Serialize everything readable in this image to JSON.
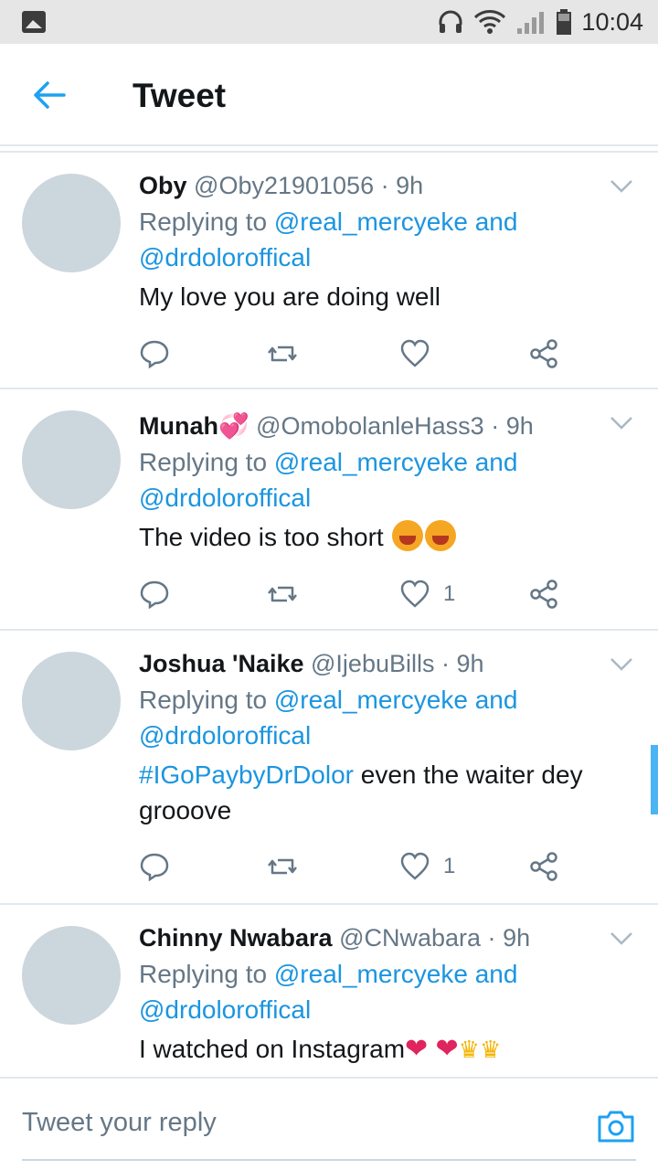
{
  "status_bar": {
    "time": "10:04"
  },
  "header": {
    "title": "Tweet"
  },
  "tweets": [
    {
      "name": "Oby",
      "name_emoji": "",
      "handle": "@Oby21901056",
      "dot": "·",
      "time": "9h",
      "replying_prefix": "Replying to",
      "mention1": "@real_mercyeke",
      "and": "and",
      "mention2": "@drdoloroffical",
      "text": "My love you are doing well",
      "like_count": ""
    },
    {
      "name": "Munah",
      "name_emoji": "💞",
      "handle": "@OmobolanleHass3",
      "dot": "·",
      "time": "9h",
      "replying_prefix": "Replying to",
      "mention1": "@real_mercyeke",
      "and": "and",
      "mention2": "@drdoloroffical",
      "text": "The video is too short",
      "like_count": "1"
    },
    {
      "name": "Joshua 'Naike",
      "handle": "@IjebuBills",
      "dot": "·",
      "time": "9h",
      "replying_prefix": "Replying to",
      "mention1": "@real_mercyeke",
      "and": "and",
      "mention2": "@drdoloroffical",
      "hashtag": "#IGoPaybyDrDolor",
      "text": "even the waiter dey grooove",
      "like_count": "1"
    },
    {
      "name": "Chinny Nwabara",
      "handle": "@CNwabara",
      "dot": "·",
      "time": "9h",
      "replying_prefix": "Replying to",
      "mention1": "@real_mercyeke",
      "and": "and",
      "mention2": "@drdoloroffical",
      "text": "I watched on Instagram",
      "emoji_tail": "❤ ❤",
      "crowns": "♛♛"
    }
  ],
  "reply_bar": {
    "placeholder": "Tweet your reply"
  },
  "colors": {
    "accent": "#1b95e0",
    "secondary_text": "#657786",
    "divider": "#e1e8ed",
    "avatar": "#ccd6dd"
  }
}
